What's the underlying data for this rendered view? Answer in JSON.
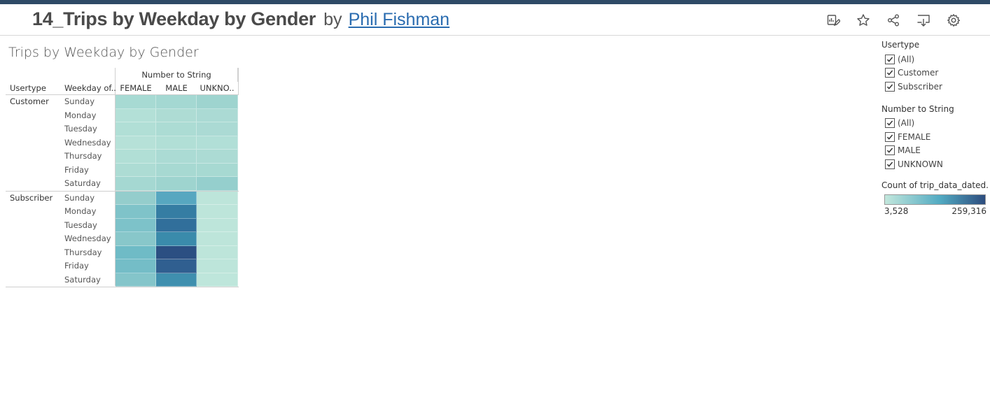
{
  "header": {
    "viz_title": "14_Trips by Weekday by Gender",
    "by": "by",
    "author": "Phil Fishman",
    "toolbar_icons": [
      "edit-icon",
      "star-icon",
      "share-icon",
      "download-icon",
      "settings-icon"
    ]
  },
  "sheet": {
    "title": "Trips by Weekday by Gender"
  },
  "crosstab": {
    "column_group_header": "Number to String",
    "row_headers": {
      "usertype": "Usertype",
      "weekday": "Weekday of.."
    },
    "columns": [
      "FEMALE",
      "MALE",
      "UNKNO.."
    ],
    "groups": [
      {
        "name": "Customer",
        "rows": [
          {
            "day": "Sunday",
            "colors": [
              "#a7dad3",
              "#a4d8d2",
              "#9ed4cf"
            ]
          },
          {
            "day": "Monday",
            "colors": [
              "#b3e0d7",
              "#aedcd4",
              "#abdad4"
            ]
          },
          {
            "day": "Tuesday",
            "colors": [
              "#b1dfd6",
              "#acdcd4",
              "#abdad4"
            ]
          },
          {
            "day": "Wednesday",
            "colors": [
              "#b6e1d8",
              "#b1dfd6",
              "#b1dfd7"
            ]
          },
          {
            "day": "Thursday",
            "colors": [
              "#b1dfd6",
              "#abdbd4",
              "#acdbd4"
            ]
          },
          {
            "day": "Friday",
            "colors": [
              "#addcd4",
              "#a7d9d2",
              "#a7d9d2"
            ]
          },
          {
            "day": "Saturday",
            "colors": [
              "#a5d8d2",
              "#9ed4cf",
              "#95cfcd"
            ]
          }
        ]
      },
      {
        "name": "Subscriber",
        "rows": [
          {
            "day": "Sunday",
            "colors": [
              "#94cdcc",
              "#57a7c0",
              "#bde5da"
            ]
          },
          {
            "day": "Monday",
            "colors": [
              "#7fc3c9",
              "#357da3",
              "#bde5da"
            ]
          },
          {
            "day": "Tuesday",
            "colors": [
              "#7dc2c9",
              "#316f9b",
              "#bde5da"
            ]
          },
          {
            "day": "Wednesday",
            "colors": [
              "#88c7ca",
              "#3a8bab",
              "#bde5da"
            ]
          },
          {
            "day": "Thursday",
            "colors": [
              "#6fbbc6",
              "#2b4f82",
              "#bde5da"
            ]
          },
          {
            "day": "Friday",
            "colors": [
              "#74bdc7",
              "#305f90",
              "#bde5da"
            ]
          },
          {
            "day": "Saturday",
            "colors": [
              "#84c5ca",
              "#3f8fae",
              "#bee6db"
            ]
          }
        ]
      }
    ]
  },
  "filters": {
    "usertype": {
      "title": "Usertype",
      "items": [
        "(All)",
        "Customer",
        "Subscriber"
      ]
    },
    "gender": {
      "title": "Number to String",
      "items": [
        "(All)",
        "FEMALE",
        "MALE",
        "UNKNOWN"
      ]
    }
  },
  "legend": {
    "title": "Count of trip_data_dated...",
    "min_label": "3,528",
    "max_label": "259,316",
    "color_low": "#c2e7dc",
    "color_mid": "#52aac2",
    "color_high": "#2d4c7e"
  }
}
